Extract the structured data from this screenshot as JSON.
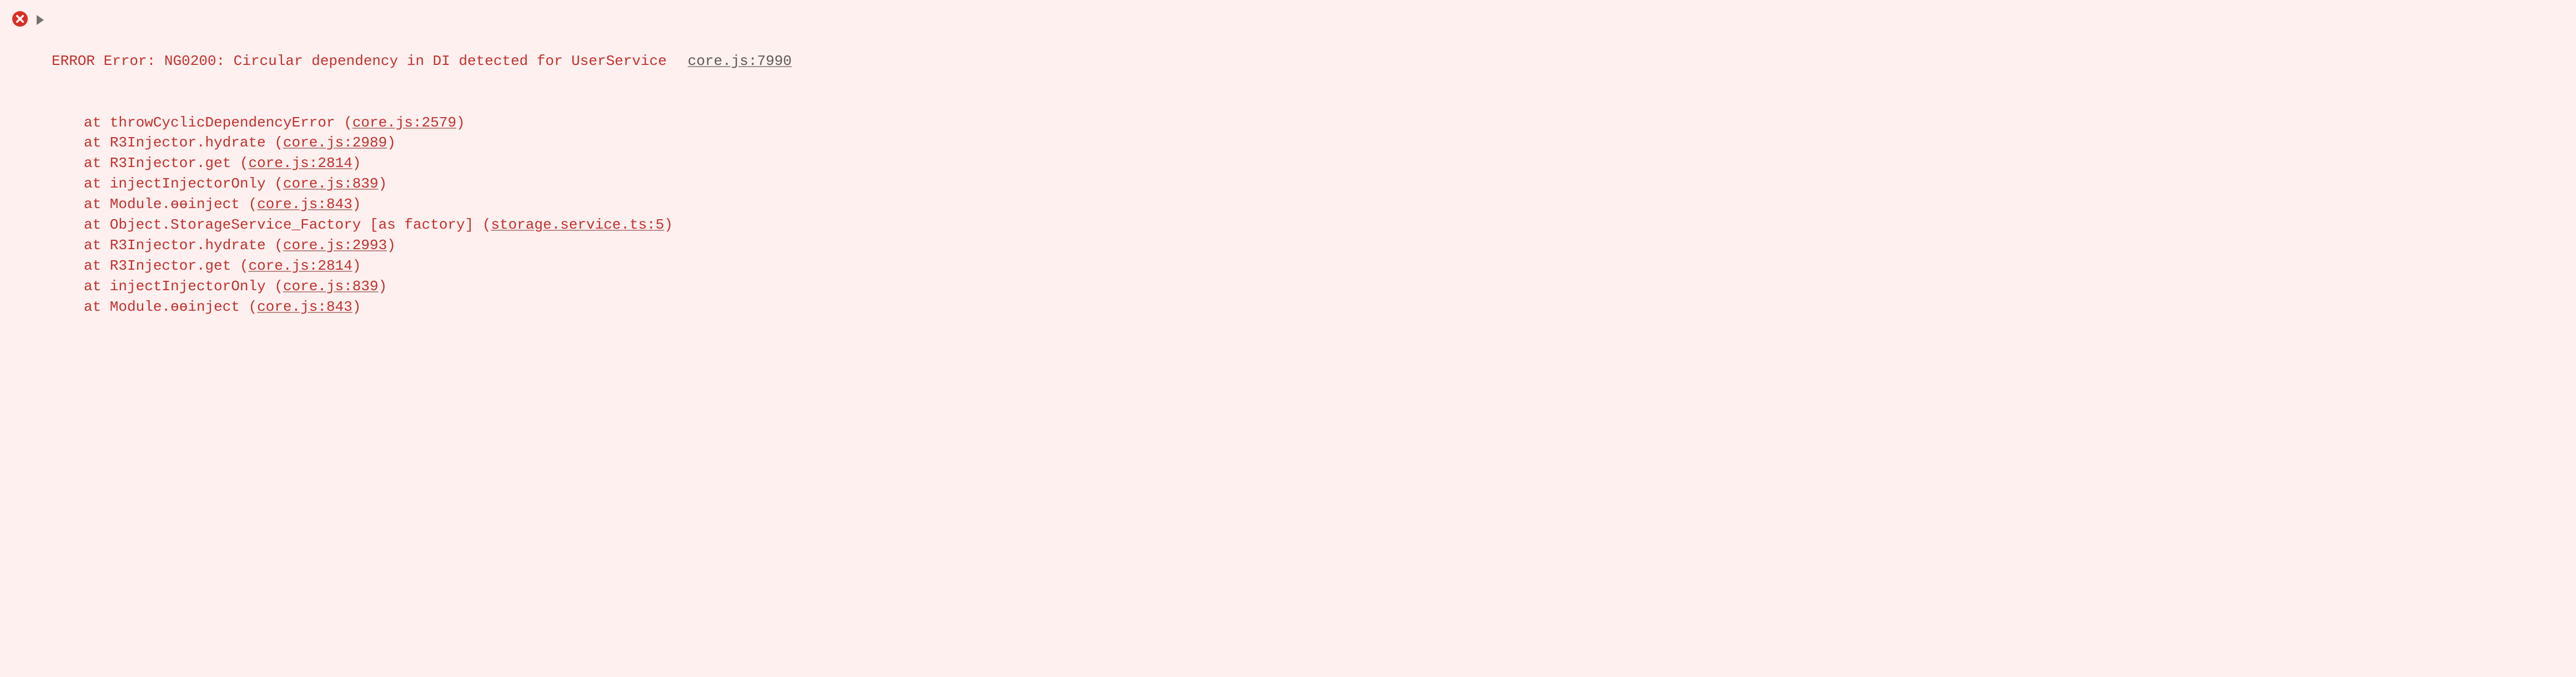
{
  "error": {
    "label": "ERROR",
    "message": "Error: NG0200: Circular dependency in DI detected for UserService",
    "source_link": "core.js:7990",
    "stack": [
      {
        "prefix": "at throwCyclicDependencyError (",
        "link": "core.js:2579",
        "suffix": ")"
      },
      {
        "prefix": "at R3Injector.hydrate (",
        "link": "core.js:2989",
        "suffix": ")"
      },
      {
        "prefix": "at R3Injector.get (",
        "link": "core.js:2814",
        "suffix": ")"
      },
      {
        "prefix": "at injectInjectorOnly (",
        "link": "core.js:839",
        "suffix": ")"
      },
      {
        "prefix": "at Module.ɵɵinject (",
        "link": "core.js:843",
        "suffix": ")"
      },
      {
        "prefix": "at Object.StorageService_Factory [as factory] (",
        "link": "storage.service.ts:5",
        "suffix": ")"
      },
      {
        "prefix": "at R3Injector.hydrate (",
        "link": "core.js:2993",
        "suffix": ")"
      },
      {
        "prefix": "at R3Injector.get (",
        "link": "core.js:2814",
        "suffix": ")"
      },
      {
        "prefix": "at injectInjectorOnly (",
        "link": "core.js:839",
        "suffix": ")"
      },
      {
        "prefix": "at Module.ɵɵinject (",
        "link": "core.js:843",
        "suffix": ")"
      }
    ]
  }
}
